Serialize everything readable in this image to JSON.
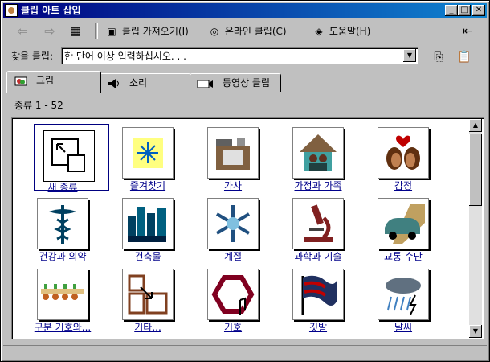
{
  "window": {
    "title": "클립 아트 삽입"
  },
  "toolbar": {
    "import": "클립 가져오기(I)",
    "online": "온라인 클립(C)",
    "help": "도움말(H)"
  },
  "search": {
    "label": "찾을 클립:",
    "value": "한 단어 이상 입력하십시오. . ."
  },
  "tabs": [
    {
      "label": "그림"
    },
    {
      "label": "소리"
    },
    {
      "label": "동영상 클립"
    }
  ],
  "count": "종류 1 - 52",
  "items": [
    {
      "label": "새 종류",
      "icon": "new-category-icon"
    },
    {
      "label": "즐겨찾기",
      "icon": "favorites-icon"
    },
    {
      "label": "가사",
      "icon": "household-icon"
    },
    {
      "label": "가정과 가족",
      "icon": "home-family-icon"
    },
    {
      "label": "감정",
      "icon": "emotions-icon"
    },
    {
      "label": "건강과 의약",
      "icon": "health-medicine-icon"
    },
    {
      "label": "건축물",
      "icon": "buildings-icon"
    },
    {
      "label": "계절",
      "icon": "snowflake-icon"
    },
    {
      "label": "과학과 기술",
      "icon": "microscope-icon"
    },
    {
      "label": "교통 수단",
      "icon": "car-icon"
    },
    {
      "label": "구분 기호와...",
      "icon": "dividers-icon"
    },
    {
      "label": "기타...",
      "icon": "misc-icon"
    },
    {
      "label": "기호",
      "icon": "symbols-icon"
    },
    {
      "label": "깃발",
      "icon": "flag-icon"
    },
    {
      "label": "날씨",
      "icon": "weather-icon"
    }
  ]
}
